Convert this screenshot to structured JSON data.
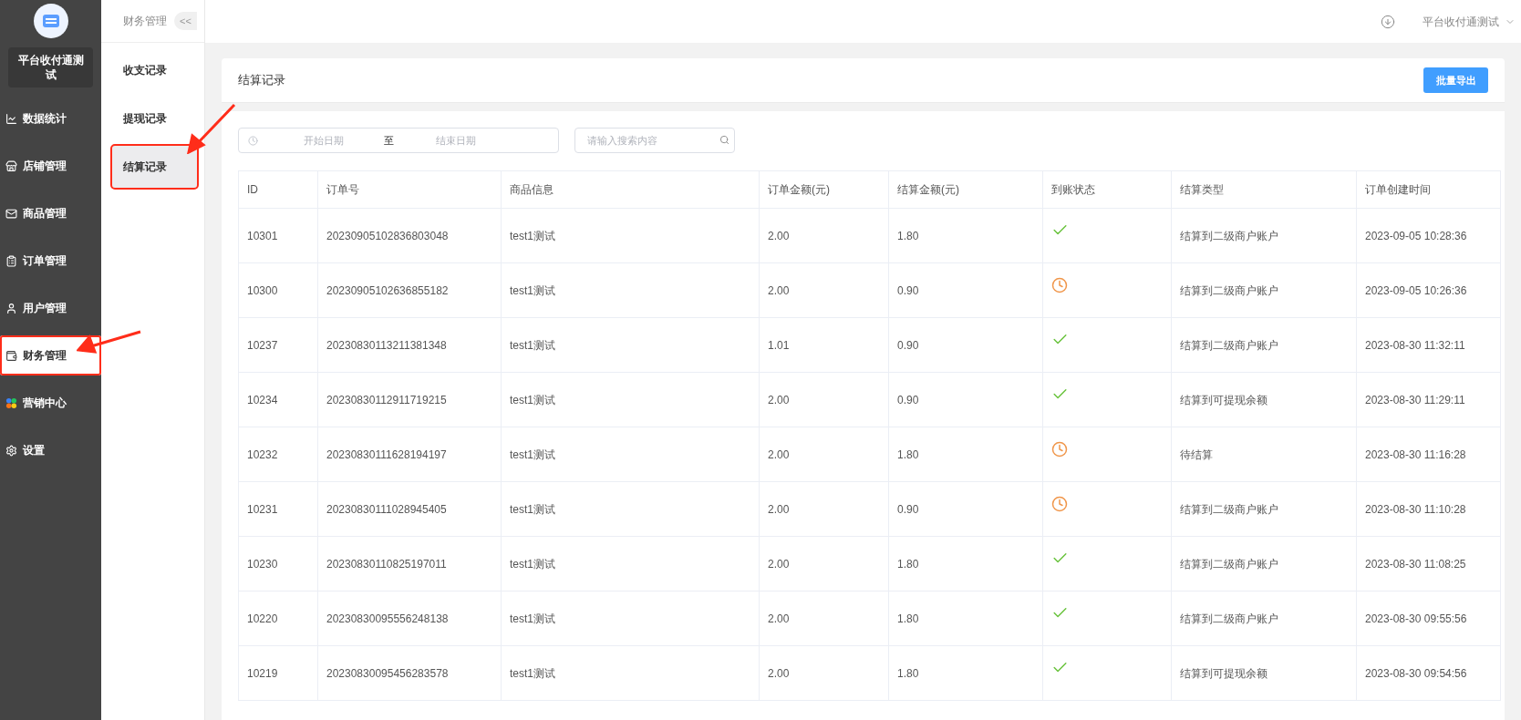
{
  "sidebar": {
    "brand": "平台收付通测试",
    "items": [
      {
        "label": "数据统计",
        "selected": false,
        "annotated": false
      },
      {
        "label": "店铺管理",
        "selected": false,
        "annotated": false
      },
      {
        "label": "商品管理",
        "selected": false,
        "annotated": false
      },
      {
        "label": "订单管理",
        "selected": false,
        "annotated": false
      },
      {
        "label": "用户管理",
        "selected": false,
        "annotated": false
      },
      {
        "label": "财务管理",
        "selected": true,
        "annotated": true
      },
      {
        "label": "营销中心",
        "selected": false,
        "annotated": false
      },
      {
        "label": "设置",
        "selected": false,
        "annotated": false
      }
    ]
  },
  "submenu": {
    "title": "财务管理",
    "collapse": "<<",
    "items": [
      {
        "label": "收支记录",
        "selected": false,
        "annotated": false
      },
      {
        "label": "提现记录",
        "selected": false,
        "annotated": false
      },
      {
        "label": "结算记录",
        "selected": true,
        "annotated": true
      }
    ]
  },
  "header": {
    "account": "平台收付通测试"
  },
  "page": {
    "title": "结算记录",
    "export_button": "批量导出"
  },
  "filters": {
    "start_placeholder": "开始日期",
    "separator": "至",
    "end_placeholder": "结束日期",
    "search_placeholder": "请输入搜索内容"
  },
  "table": {
    "columns": [
      "ID",
      "订单号",
      "商品信息",
      "订单金额(元)",
      "结算金额(元)",
      "到账状态",
      "结算类型",
      "订单创建时间"
    ],
    "rows": [
      {
        "id": "10301",
        "order_no": "20230905102836803048",
        "product": "test1测试",
        "order_amount": "2.00",
        "settle_amount": "1.80",
        "settled": true,
        "settle_type": "结算到二级商户账户",
        "created": "2023-09-05 10:28:36"
      },
      {
        "id": "10300",
        "order_no": "20230905102636855182",
        "product": "test1测试",
        "order_amount": "2.00",
        "settle_amount": "0.90",
        "settled": false,
        "settle_type": "结算到二级商户账户",
        "created": "2023-09-05 10:26:36"
      },
      {
        "id": "10237",
        "order_no": "20230830113211381348",
        "product": "test1测试",
        "order_amount": "1.01",
        "settle_amount": "0.90",
        "settled": true,
        "settle_type": "结算到二级商户账户",
        "created": "2023-08-30 11:32:11"
      },
      {
        "id": "10234",
        "order_no": "20230830112911719215",
        "product": "test1测试",
        "order_amount": "2.00",
        "settle_amount": "0.90",
        "settled": true,
        "settle_type": "结算到可提现余额",
        "created": "2023-08-30 11:29:11"
      },
      {
        "id": "10232",
        "order_no": "20230830111628194197",
        "product": "test1测试",
        "order_amount": "2.00",
        "settle_amount": "1.80",
        "settled": false,
        "settle_type": "待结算",
        "created": "2023-08-30 11:16:28"
      },
      {
        "id": "10231",
        "order_no": "20230830111028945405",
        "product": "test1测试",
        "order_amount": "2.00",
        "settle_amount": "0.90",
        "settled": false,
        "settle_type": "结算到二级商户账户",
        "created": "2023-08-30 11:10:28"
      },
      {
        "id": "10230",
        "order_no": "20230830110825197011",
        "product": "test1测试",
        "order_amount": "2.00",
        "settle_amount": "1.80",
        "settled": true,
        "settle_type": "结算到二级商户账户",
        "created": "2023-08-30 11:08:25"
      },
      {
        "id": "10220",
        "order_no": "20230830095556248138",
        "product": "test1测试",
        "order_amount": "2.00",
        "settle_amount": "1.80",
        "settled": true,
        "settle_type": "结算到二级商户账户",
        "created": "2023-08-30 09:55:56"
      },
      {
        "id": "10219",
        "order_no": "20230830095456283578",
        "product": "test1测试",
        "order_amount": "2.00",
        "settle_amount": "1.80",
        "settled": true,
        "settle_type": "结算到可提现余额",
        "created": "2023-08-30 09:54:56"
      }
    ]
  }
}
